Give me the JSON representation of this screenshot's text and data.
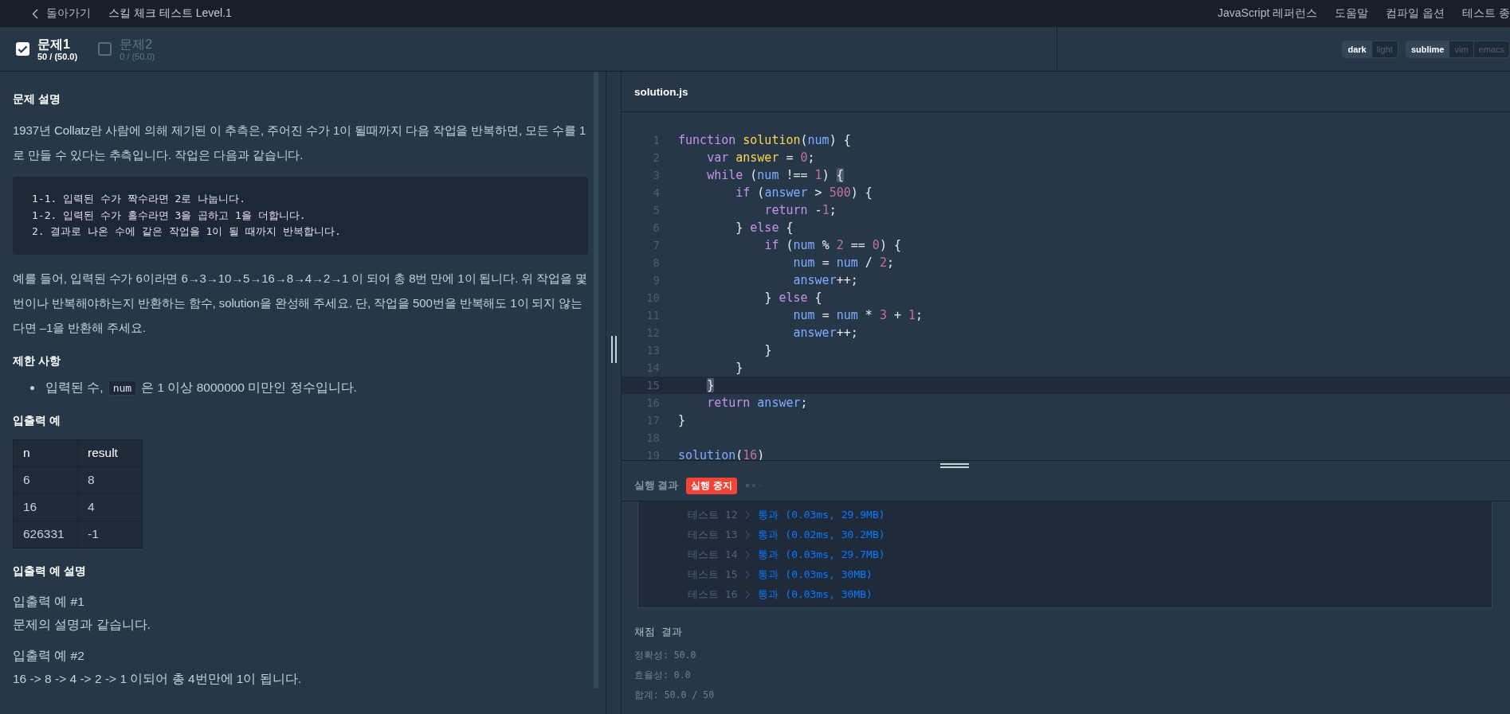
{
  "topbar": {
    "back_label": "돌아가기",
    "title": "스킬 체크 테스트 Level.1",
    "links": [
      "JavaScript 레퍼런스",
      "도움말",
      "컴파일 옵션",
      "테스트 종"
    ]
  },
  "problems": [
    {
      "label": "문제1",
      "score": "50 / (50.0)",
      "checked": true,
      "selected": true
    },
    {
      "label": "문제2",
      "score": "0 / (50.0)",
      "checked": false,
      "selected": false
    }
  ],
  "theme_toggle": [
    {
      "label": "dark",
      "selected": true
    },
    {
      "label": "light",
      "selected": false
    }
  ],
  "keymap_toggle": [
    {
      "label": "sublime",
      "selected": true
    },
    {
      "label": "vim",
      "selected": false
    },
    {
      "label": "emacs",
      "selected": false
    }
  ],
  "description": [
    {
      "kind": "heading",
      "text": "문제 설명"
    },
    {
      "kind": "paragraph",
      "text": "1937년 Collatz란 사람에 의해 제기된 이 추측은, 주어진 수가 1이 될때까지 다음 작업을 반복하면, 모든 수를 1로 만들 수 있다는 추측입니다. 작업은 다음과 같습니다."
    },
    {
      "kind": "code",
      "lines": [
        "1-1. 입력된 수가 짝수라면 2로 나눕니다.",
        "1-2. 입력된 수가 홀수라면 3을 곱하고 1을 더합니다.",
        "2. 결과로 나온 수에 같은 작업을 1이 될 때까지 반복합니다."
      ]
    },
    {
      "kind": "paragraph",
      "text": "예를 들어, 입력된 수가 6이라면 6→3→10→5→16→8→4→2→1 이 되어 총 8번 만에 1이 됩니다. 위 작업을 몇 번이나 반복해야하는지 반환하는 함수, solution을 완성해 주세요. 단, 작업을 500번을 반복해도 1이 되지 않는다면 –1을 반환해 주세요."
    },
    {
      "kind": "heading",
      "text": "제한 사항"
    },
    {
      "kind": "bullets",
      "items": [
        {
          "before": "입력된 수,",
          "code": "num",
          "after": "은 1 이상 8000000 미만인 정수입니다."
        }
      ]
    },
    {
      "kind": "heading",
      "text": "입출력 예"
    },
    {
      "kind": "table",
      "columns": [
        "n",
        "result"
      ],
      "rows": [
        [
          "6",
          "8"
        ],
        [
          "16",
          "4"
        ],
        [
          "626331",
          "-1"
        ]
      ]
    },
    {
      "kind": "heading",
      "text": "입출력 예 설명"
    },
    {
      "kind": "example",
      "title": "입출력 예 #1",
      "text": "문제의 설명과 같습니다."
    },
    {
      "kind": "example",
      "title": "입출력 예 #2",
      "text": "16 -> 8 -> 4 -> 2 -> 1 이되어 총 4번만에 1이 됩니다."
    }
  ],
  "editor": {
    "filename": "solution.js",
    "lines": [
      {
        "n": "1",
        "active": false,
        "code": "function solution(num) {"
      },
      {
        "n": "2",
        "active": false,
        "code": "    var answer = 0;"
      },
      {
        "n": "3",
        "active": false,
        "code": "    while (num !== 1) {"
      },
      {
        "n": "4",
        "active": false,
        "code": "        if (answer > 500) {"
      },
      {
        "n": "5",
        "active": false,
        "code": "            return -1;"
      },
      {
        "n": "6",
        "active": false,
        "code": "        } else {"
      },
      {
        "n": "7",
        "active": false,
        "code": "            if (num % 2 == 0) {"
      },
      {
        "n": "8",
        "active": false,
        "code": "                num = num / 2;"
      },
      {
        "n": "9",
        "active": false,
        "code": "                answer++;"
      },
      {
        "n": "10",
        "active": false,
        "code": "            } else {"
      },
      {
        "n": "11",
        "active": false,
        "code": "                num = num * 3 + 1;"
      },
      {
        "n": "12",
        "active": false,
        "code": "                answer++;"
      },
      {
        "n": "13",
        "active": false,
        "code": "            }"
      },
      {
        "n": "14",
        "active": false,
        "code": "        }"
      },
      {
        "n": "15",
        "active": true,
        "code": "    }"
      },
      {
        "n": "16",
        "active": false,
        "code": "    return answer;"
      },
      {
        "n": "17",
        "active": false,
        "code": "}"
      },
      {
        "n": "18",
        "active": false
      },
      {
        "n": "19",
        "active": false,
        "code": "solution(16)"
      }
    ]
  },
  "run": {
    "title": "실행 결과",
    "badge": "실행 중지",
    "running": true,
    "results": [
      {
        "test": "테스트 12",
        "result": "통과 (0.03ms, 29.9MB)",
        "passed": true
      },
      {
        "test": "테스트 13",
        "result": "통과 (0.02ms, 30.2MB)",
        "passed": true
      },
      {
        "test": "테스트 14",
        "result": "통과 (0.03ms, 29.7MB)",
        "passed": true
      },
      {
        "test": "테스트 15",
        "result": "통과 (0.03ms, 30MB)",
        "passed": true
      },
      {
        "test": "테스트 16",
        "result": "통과 (0.03ms, 30MB)",
        "passed": true
      }
    ],
    "grade_title": "채점 결과",
    "grade_lines": [
      "정확성: 50.0",
      "효율성: 0.0",
      "합계: 50.0 / 50"
    ]
  }
}
